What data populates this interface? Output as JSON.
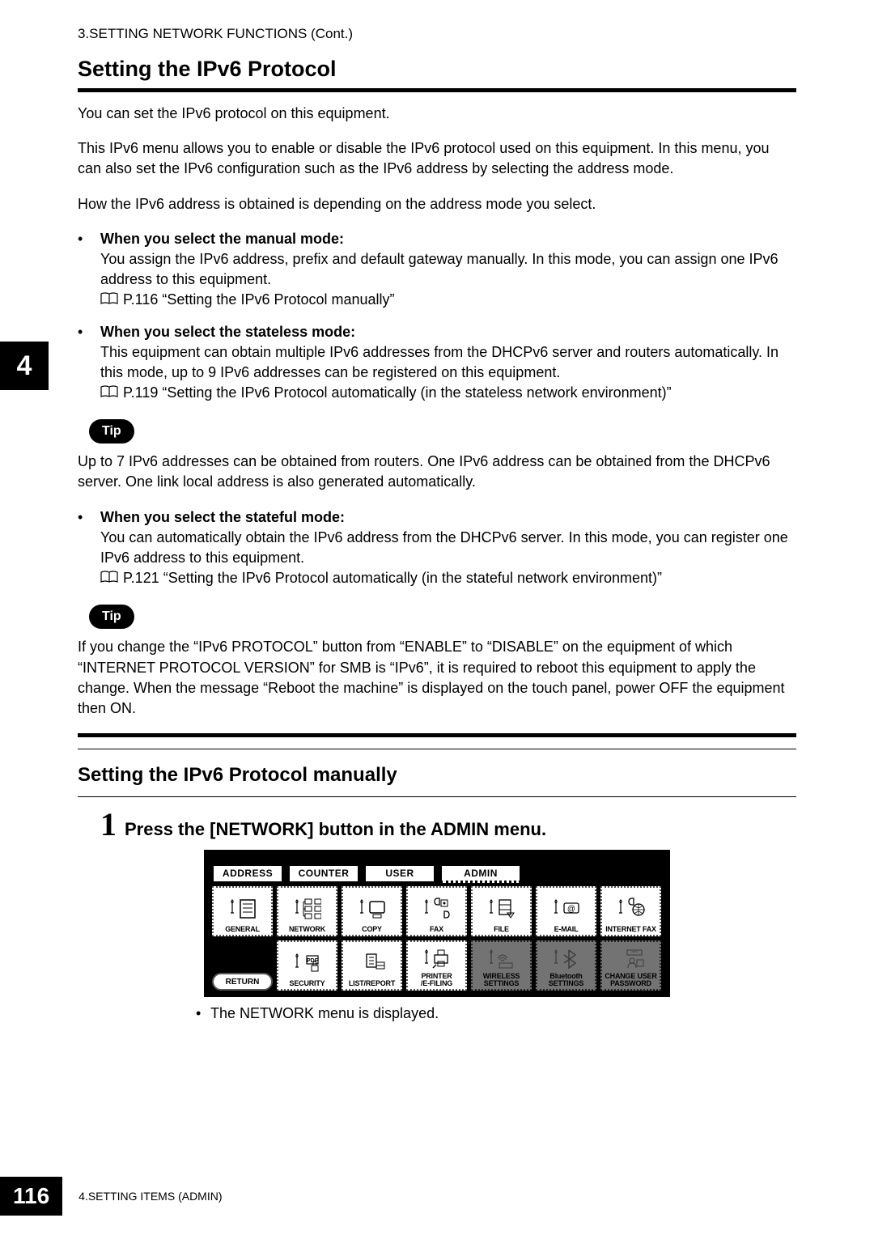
{
  "header": "3.SETTING NETWORK FUNCTIONS (Cont.)",
  "sideTab": "4",
  "section1": {
    "title": "Setting the IPv6 Protocol",
    "p1": "You can set the IPv6 protocol on this equipment.",
    "p2": "This IPv6 menu allows you to enable or disable the IPv6 protocol used on this equipment.  In this menu, you can also set the IPv6 configuration such as the IPv6 address by selecting the address mode.",
    "p3": "How the IPv6 address is obtained is depending on the address mode you select."
  },
  "bullet1": {
    "head": "When you select the manual mode:",
    "body": "You assign the IPv6 address, prefix and default gateway manually. In this mode, you can assign one IPv6 address to this equipment.",
    "ref": "P.116 “Setting the IPv6 Protocol manually”"
  },
  "bullet2": {
    "head": "When you select the stateless mode:",
    "body": "This equipment can obtain multiple IPv6 addresses from the DHCPv6 server and routers automatically. In this mode, up to 9 IPv6 addresses can be registered on this equipment.",
    "ref": "P.119 “Setting the IPv6 Protocol automatically (in the stateless network environment)”"
  },
  "tipLabel": "Tip",
  "tip1": "Up to 7 IPv6 addresses can be obtained from routers. One IPv6 address can be obtained from the DHCPv6 server. One link local address is also generated automatically.",
  "bullet3": {
    "head": "When you select the stateful mode:",
    "body": "You can automatically obtain the IPv6 address from the DHCPv6 server. In this mode, you can register one IPv6 address to this equipment.",
    "ref": "P.121 “Setting the IPv6 Protocol automatically (in the stateful network environment)”"
  },
  "tip2": "If you change the “IPv6 PROTOCOL” button from “ENABLE” to “DISABLE” on the equipment of which “INTERNET PROTOCOL VERSION” for SMB is “IPv6”, it is required to reboot this equipment to apply the change. When the message “Reboot the machine” is displayed on the touch panel, power OFF the equipment then ON.",
  "section2": {
    "title": "Setting the IPv6 Protocol manually",
    "stepNum": "1",
    "stepText": "Press the [NETWORK] button in the ADMIN menu.",
    "subBullet": "The NETWORK menu is displayed."
  },
  "panel": {
    "tabs": {
      "address": "ADDRESS",
      "counter": "COUNTER",
      "user": "USER",
      "admin": "ADMIN"
    },
    "btns": {
      "general": "GENERAL",
      "network": "NETWORK",
      "copy": "COPY",
      "fax": "FAX",
      "file": "FILE",
      "email": "E-MAIL",
      "internetfax": "INTERNET FAX",
      "security": "SECURITY",
      "listreport": "LIST/REPORT",
      "printer": "PRINTER\n/E-FILING",
      "wireless": "WIRELESS\nSETTINGS",
      "bluetooth": "Bluetooth\nSETTINGS",
      "changepw": "CHANGE USER\nPASSWORD",
      "return": "RETURN"
    }
  },
  "footer": {
    "page": "116",
    "text": "4.SETTING ITEMS (ADMIN)"
  }
}
